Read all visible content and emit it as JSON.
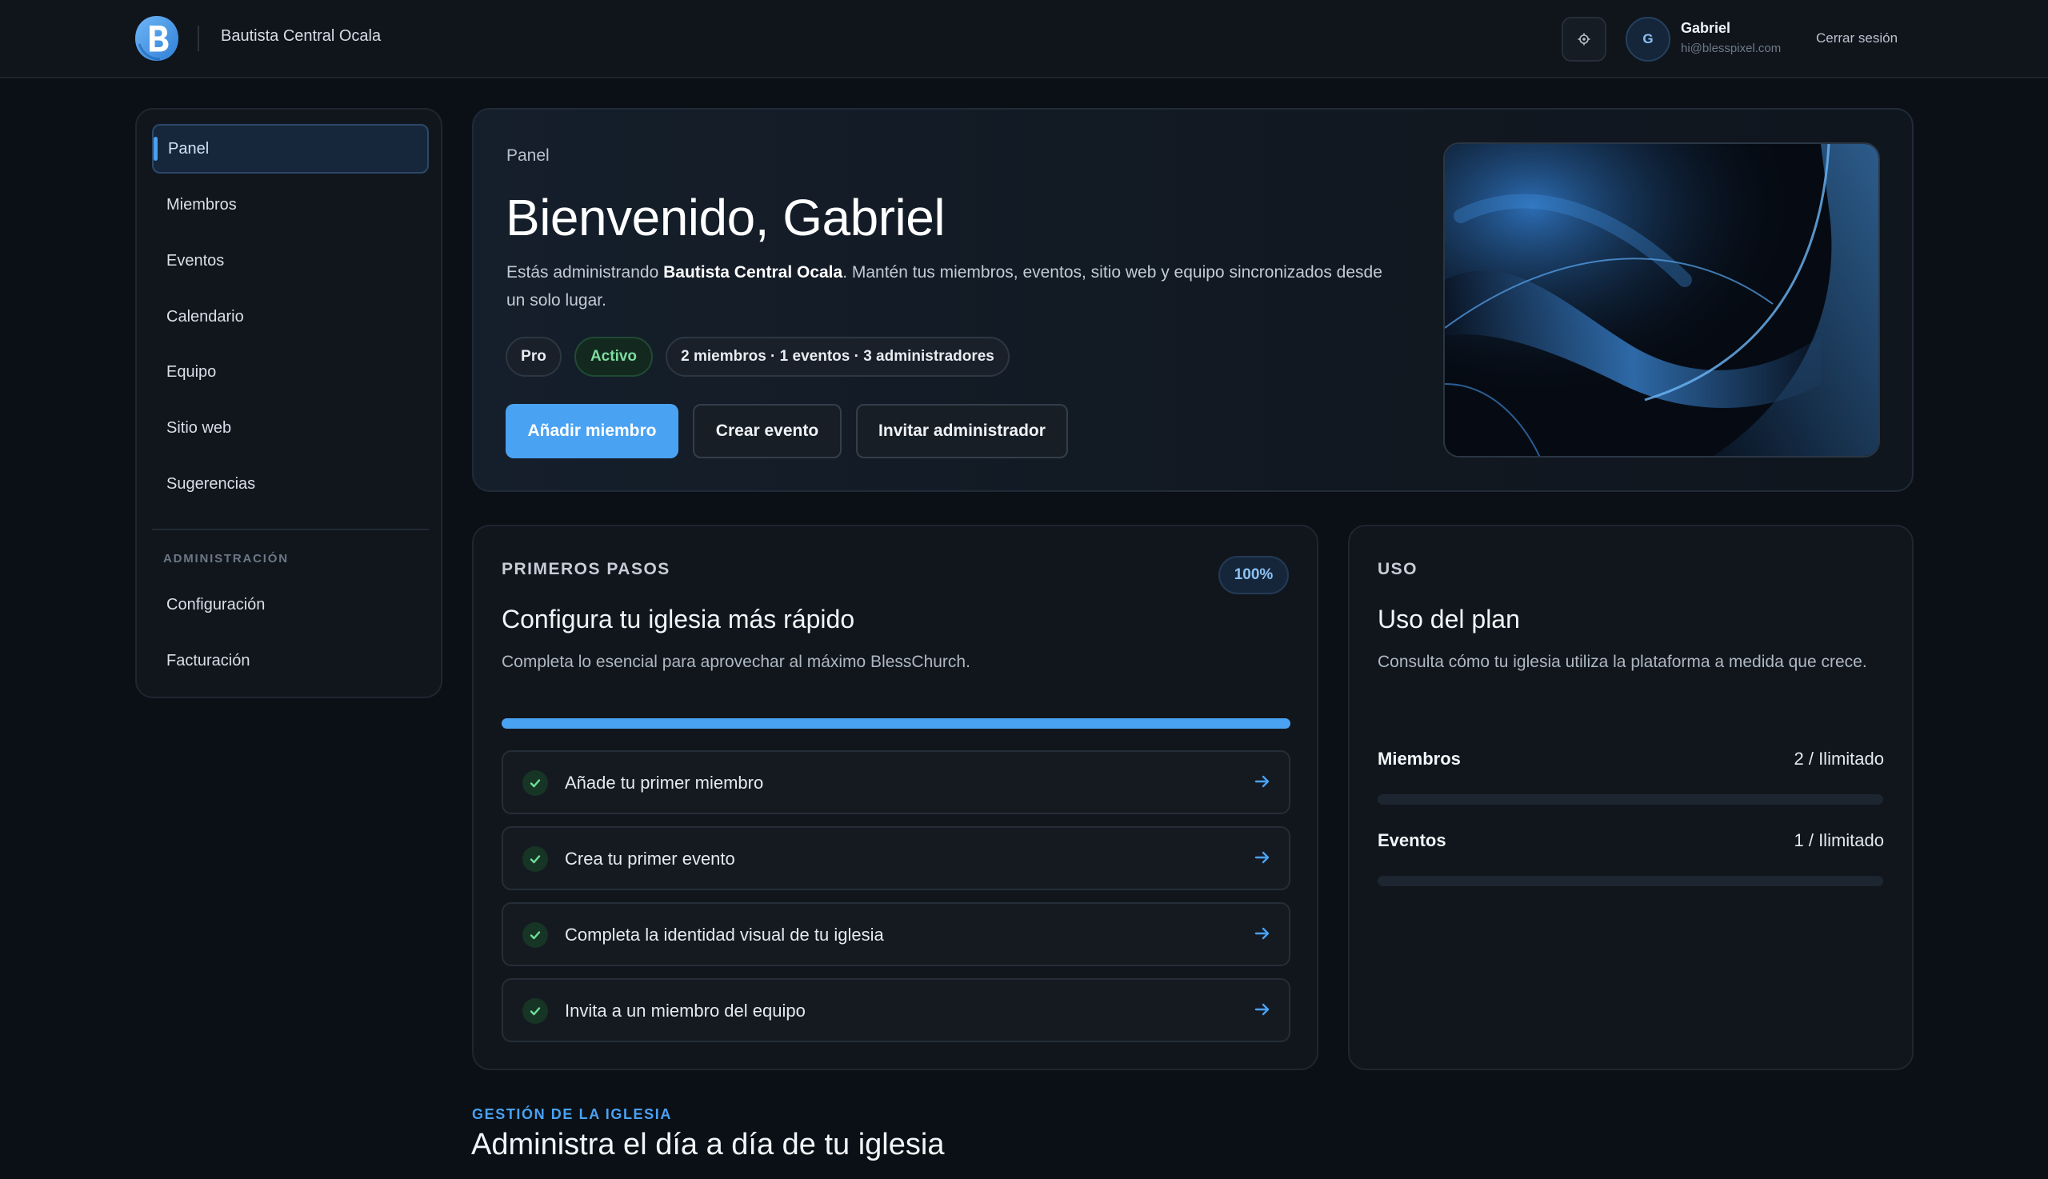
{
  "header": {
    "logo_letter": "B",
    "church_name": "Bautista Central Ocala",
    "settings_icon": "gear-icon",
    "user": {
      "initial": "G",
      "name": "Gabriel",
      "email": "hi@blesspixel.com"
    },
    "logout_label": "Cerrar sesión"
  },
  "sidebar": {
    "items": [
      {
        "label": "Panel",
        "active": true
      },
      {
        "label": "Miembros"
      },
      {
        "label": "Eventos"
      },
      {
        "label": "Calendario"
      },
      {
        "label": "Equipo"
      },
      {
        "label": "Sitio web"
      },
      {
        "label": "Sugerencias"
      }
    ],
    "admin_section_label": "ADMINISTRACIÓN",
    "admin_items": [
      {
        "label": "Configuración"
      },
      {
        "label": "Facturación"
      }
    ]
  },
  "hero": {
    "eyebrow": "Panel",
    "title": "Bienvenido, Gabriel",
    "description_prefix": "Estás administrando ",
    "description_church": "Bautista Central Ocala",
    "description_suffix": ". Mantén tus miembros, eventos, sitio web y equipo sincronizados desde un solo lugar.",
    "pills": {
      "plan": "Pro",
      "status": "Activo",
      "summary": "2 miembros · 1 eventos · 3 administradores"
    },
    "buttons": {
      "add_member": "Añadir miembro",
      "create_event": "Crear evento",
      "invite_admin": "Invitar administrador"
    },
    "accent_color": "#4aa2f3"
  },
  "getting_started": {
    "eyebrow": "PRIMEROS PASOS",
    "percent_label": "100%",
    "progress": 1.0,
    "title": "Configura tu iglesia más rápido",
    "description": "Completa lo esencial para aprovechar al máximo BlessChurch.",
    "steps": [
      {
        "label": "Añade tu primer miembro",
        "done": true
      },
      {
        "label": "Crea tu primer evento",
        "done": true
      },
      {
        "label": "Completa la identidad visual de tu iglesia",
        "done": true
      },
      {
        "label": "Invita a un miembro del equipo",
        "done": true
      }
    ]
  },
  "usage": {
    "eyebrow": "USO",
    "title": "Uso del plan",
    "description": "Consulta cómo tu iglesia utiliza la plataforma a medida que crece.",
    "rows": [
      {
        "label": "Miembros",
        "value": "2 / Ilimitado",
        "fraction": 0
      },
      {
        "label": "Eventos",
        "value": "1 / Ilimitado",
        "fraction": 0
      }
    ]
  },
  "management": {
    "eyebrow": "GESTIÓN DE LA IGLESIA",
    "title": "Administra el día a día de tu iglesia"
  }
}
